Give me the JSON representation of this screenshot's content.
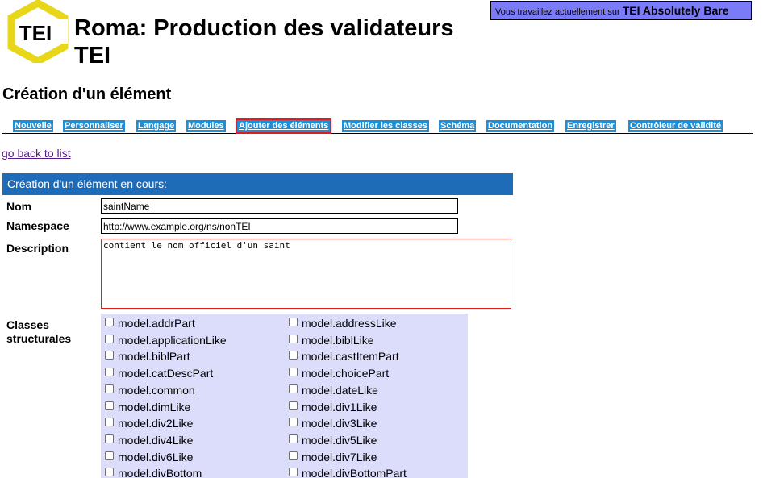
{
  "header": {
    "logo_text": "TEI",
    "title_line1": "Roma: Production des validateurs",
    "title_line2": "TEI",
    "project_prefix": "Vous travaillez actuellement sur",
    "project_name": "TEI Absolutely Bare"
  },
  "page_heading": "Création d'un élément",
  "tabs": [
    {
      "label": "Nouvelle"
    },
    {
      "label": "Personnaliser"
    },
    {
      "label": "Langage"
    },
    {
      "label": "Modules"
    },
    {
      "label": "Ajouter des éléments",
      "active": true
    },
    {
      "label": "Modifier les classes"
    },
    {
      "label": "Schéma"
    },
    {
      "label": "Documentation"
    },
    {
      "label": "Enregistrer"
    },
    {
      "label": "Contrôleur de validité"
    }
  ],
  "back_link": "go back to list",
  "form": {
    "panel_title": "Création d'un élément en cours:",
    "name_label": "Nom",
    "name_value": "saintName",
    "namespace_label": "Namespace",
    "namespace_value": "http://www.example.org/ns/nonTEI",
    "description_label": "Description",
    "description_value": "contient le nom officiel d'un saint",
    "classes_label": "Classes structurales",
    "classes_col1": [
      "model.addrPart",
      "model.applicationLike",
      "model.biblPart",
      "model.catDescPart",
      "model.common",
      "model.dimLike",
      "model.div2Like",
      "model.div4Like",
      "model.div6Like",
      "model.divBottom"
    ],
    "classes_col2": [
      "model.addressLike",
      "model.biblLike",
      "model.castItemPart",
      "model.choicePart",
      "model.dateLike",
      "model.div1Like",
      "model.div3Like",
      "model.div5Like",
      "model.div7Like",
      "model.divBottomPart"
    ]
  },
  "colors": {
    "tab_bg": "#1e8fd6",
    "panel_header_bg": "#1e6bb8",
    "project_box_bg": "#7b7bf7",
    "classes_bg": "#dcdcfb",
    "highlight_red": "#e01d1d",
    "logo_yellow": "#e8d718"
  }
}
